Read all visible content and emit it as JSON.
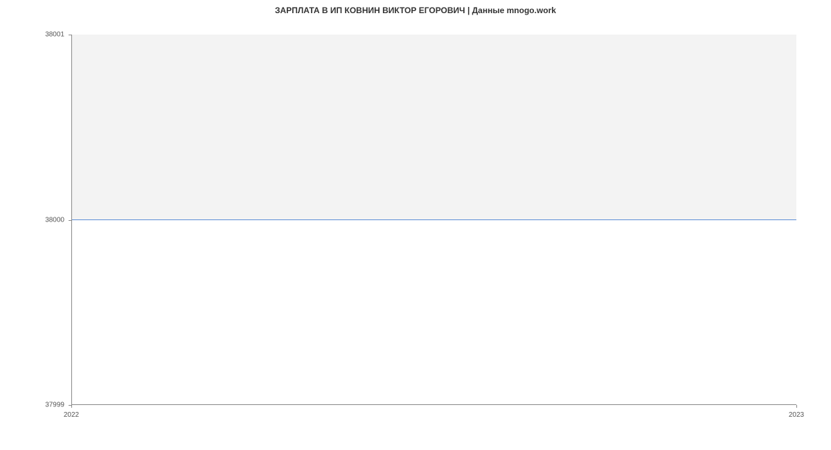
{
  "chart_data": {
    "type": "area",
    "title": "ЗАРПЛАТА В ИП КОВНИН ВИКТОР ЕГОРОВИЧ | Данные mnogo.work",
    "x": [
      2022,
      2023
    ],
    "values": [
      38000,
      38000
    ],
    "xlabel": "",
    "ylabel": "",
    "ylim": [
      37999,
      38001
    ],
    "xlim": [
      2022,
      2023
    ],
    "y_ticks": [
      37999,
      38000,
      38001
    ],
    "x_ticks": [
      2022,
      2023
    ],
    "line_color": "#5b8dd6",
    "fill_color": "#f3f3f3"
  }
}
